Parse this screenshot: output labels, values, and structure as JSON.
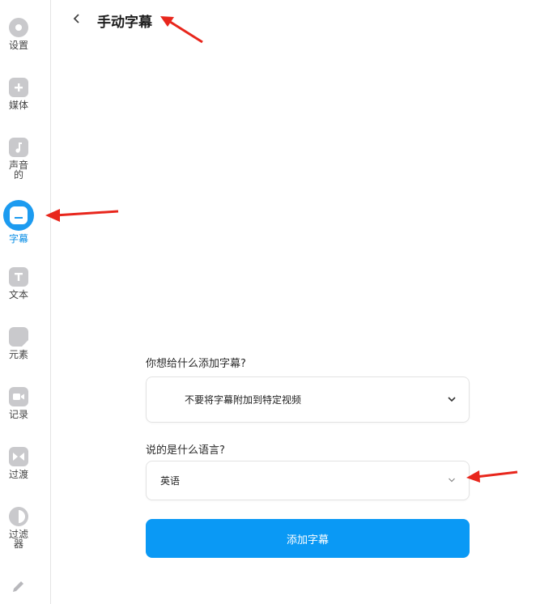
{
  "sidebar": {
    "items": [
      {
        "label": "设置",
        "icon": "gear-icon"
      },
      {
        "label": "媒体",
        "icon": "plus-icon"
      },
      {
        "label": "声音的",
        "icon": "music-note-icon"
      },
      {
        "label": "字幕",
        "icon": "subtitles-icon",
        "active": true
      },
      {
        "label": "文本",
        "icon": "text-t-icon"
      },
      {
        "label": "元素",
        "icon": "sticky-note-icon"
      },
      {
        "label": "记录",
        "icon": "camera-icon"
      },
      {
        "label": "过渡",
        "icon": "transition-icon"
      },
      {
        "label": "过滤器",
        "icon": "half-circle-icon"
      },
      {
        "label": "",
        "icon": "pencil-icon"
      }
    ]
  },
  "header": {
    "title": "手动字幕",
    "back_icon": "chevron-left-icon"
  },
  "form": {
    "target_label": "你想给什么添加字幕?",
    "target_value": "不要将字幕附加到特定视频",
    "language_label": "说的是什么语言?",
    "language_value": "英语",
    "submit_label": "添加字幕"
  },
  "colors": {
    "accent": "#0a99f5",
    "annotation_arrow": "#e8261c"
  }
}
